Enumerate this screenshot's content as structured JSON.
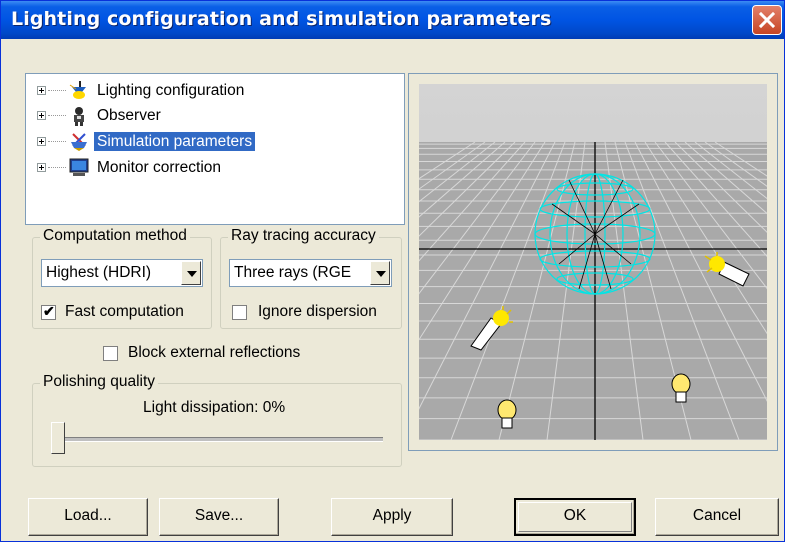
{
  "window": {
    "title": "Lighting configuration and simulation parameters"
  },
  "tree": {
    "items": [
      {
        "label": "Lighting configuration",
        "icon": "lamp-icon",
        "selected": false
      },
      {
        "label": "Observer",
        "icon": "observer-icon",
        "selected": false
      },
      {
        "label": "Simulation parameters",
        "icon": "gears-icon",
        "selected": true
      },
      {
        "label": "Monitor correction",
        "icon": "monitor-icon",
        "selected": false
      }
    ]
  },
  "computation": {
    "legend": "Computation method",
    "value": "Highest (HDRI)",
    "fast_label": "Fast computation",
    "fast_checked": true
  },
  "raytracing": {
    "legend": "Ray tracing accuracy",
    "value": "Three rays (RGE",
    "dispersion_label": "Ignore dispersion",
    "dispersion_checked": false
  },
  "block": {
    "label": "Block external reflections",
    "checked": false
  },
  "polishing": {
    "legend": "Polishing quality",
    "dissipation_label": "Light dissipation: 0%",
    "slider_value": 0
  },
  "buttons": {
    "load": "Load...",
    "save": "Save...",
    "apply": "Apply",
    "ok": "OK",
    "cancel": "Cancel"
  },
  "colors": {
    "accent": "#316ac5",
    "sphere": "#00e5e5",
    "title_bar": "#0054e3"
  }
}
